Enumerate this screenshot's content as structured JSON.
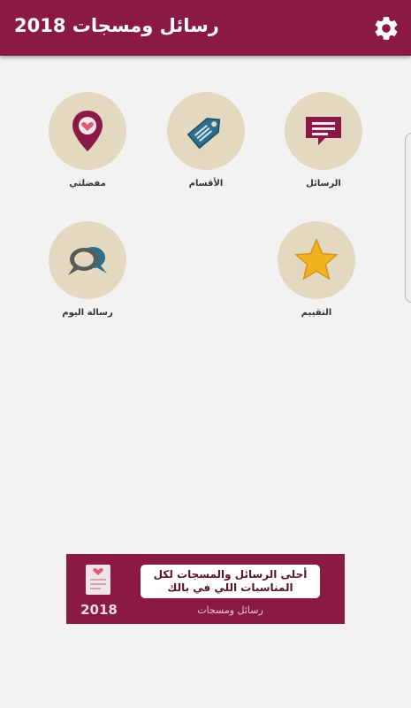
{
  "app": {
    "title": "رسائل ومسجات 2018",
    "settings_icon": "gear-icon"
  },
  "colors": {
    "appbar": "#8a1a45",
    "tile_circle": "#e3d8c0",
    "background": "#f2f2f2"
  },
  "grid": {
    "messages": {
      "label": "الرسائل",
      "icon": "message-icon"
    },
    "categories": {
      "label": "الأقسام",
      "icon": "tag-icon"
    },
    "favorites": {
      "label": "مفضلتي",
      "icon": "heart-pin-icon"
    },
    "rating": {
      "label": "التقييم",
      "icon": "star-icon"
    },
    "daily_message": {
      "label": "رسالة اليوم",
      "icon": "chat-bubbles-icon"
    }
  },
  "banner": {
    "line1": "أحلى الرسائل والمسجات لكل",
    "line2": "المناسبات اللي في بالك",
    "subtitle": "رسائل ومسجات",
    "year": "2018"
  }
}
